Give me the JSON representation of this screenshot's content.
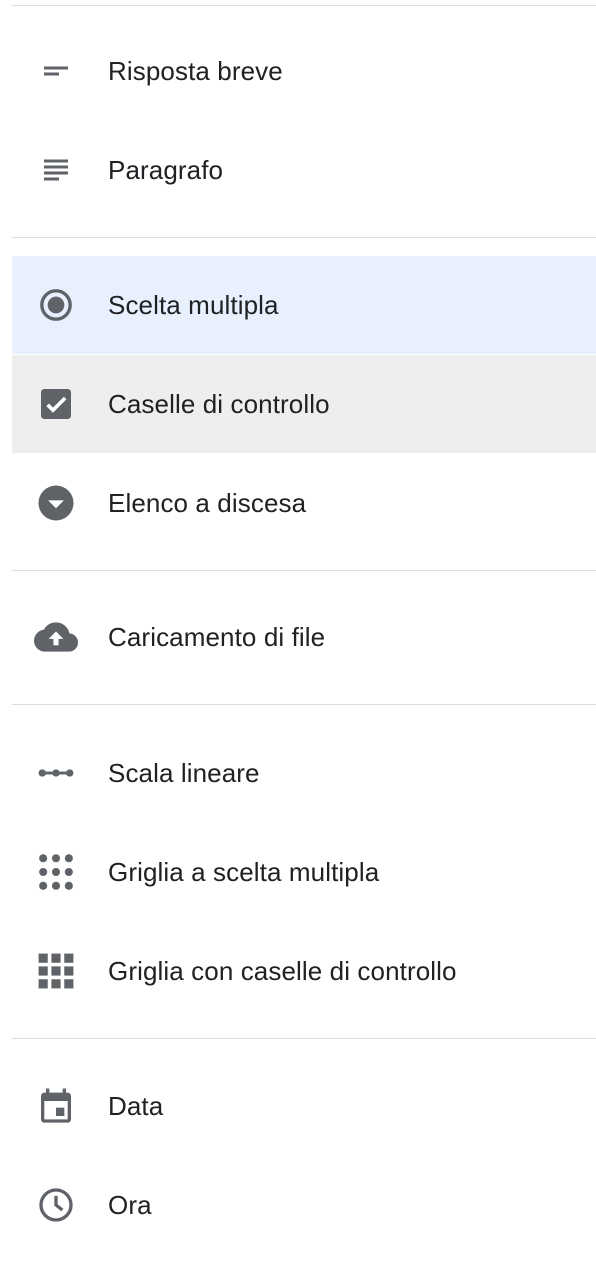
{
  "menu": {
    "items": [
      {
        "label": "Risposta breve",
        "icon": "short-answer-icon"
      },
      {
        "label": "Paragrafo",
        "icon": "paragraph-icon"
      },
      {
        "label": "Scelta multipla",
        "icon": "radio-button-icon",
        "selected": true
      },
      {
        "label": "Caselle di controllo",
        "icon": "checkbox-icon",
        "hovered": true
      },
      {
        "label": "Elenco a discesa",
        "icon": "dropdown-icon"
      },
      {
        "label": "Caricamento di file",
        "icon": "cloud-upload-icon"
      },
      {
        "label": "Scala lineare",
        "icon": "linear-scale-icon"
      },
      {
        "label": "Griglia a scelta multipla",
        "icon": "radio-grid-icon"
      },
      {
        "label": "Griglia con caselle di controllo",
        "icon": "checkbox-grid-icon"
      },
      {
        "label": "Data",
        "icon": "calendar-icon"
      },
      {
        "label": "Ora",
        "icon": "clock-icon"
      }
    ]
  },
  "colors": {
    "icon": "#5f6368",
    "text": "#202124",
    "selected_background": "#e8f0fe",
    "hover_background": "#eeeeee",
    "divider": "#dadce0"
  }
}
